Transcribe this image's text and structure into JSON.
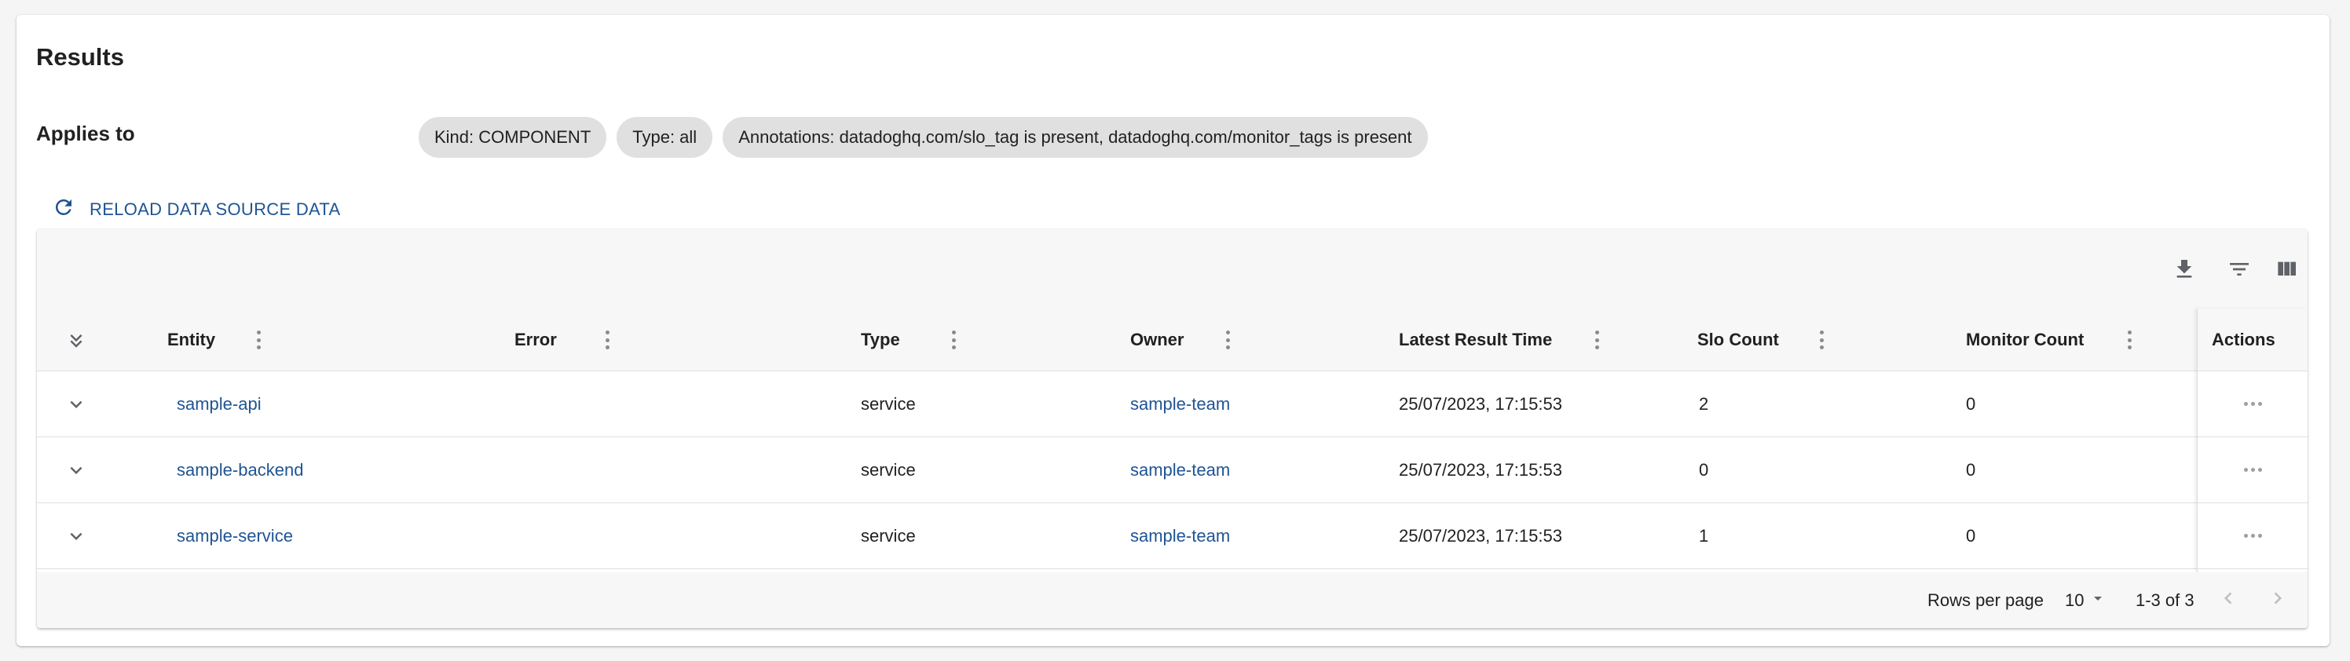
{
  "title": "Results",
  "applies_to": {
    "label": "Applies to",
    "chips": [
      "Kind: COMPONENT",
      "Type: all",
      "Annotations: datadoghq.com/slo_tag is present, datadoghq.com/monitor_tags is present"
    ]
  },
  "reload_label": "RELOAD DATA SOURCE DATA",
  "toolbar": {
    "icons": [
      "download-icon",
      "filter-icon",
      "columns-icon"
    ]
  },
  "table": {
    "columns": [
      "Entity",
      "Error",
      "Type",
      "Owner",
      "Latest Result Time",
      "Slo Count",
      "Monitor Count"
    ],
    "actions_header": "Actions",
    "rows": [
      {
        "entity": "sample-api",
        "error": "",
        "type": "service",
        "owner": "sample-team",
        "latest": "25/07/2023, 17:15:53",
        "slo": "2",
        "monitor": "0"
      },
      {
        "entity": "sample-backend",
        "error": "",
        "type": "service",
        "owner": "sample-team",
        "latest": "25/07/2023, 17:15:53",
        "slo": "0",
        "monitor": "0"
      },
      {
        "entity": "sample-service",
        "error": "",
        "type": "service",
        "owner": "sample-team",
        "latest": "25/07/2023, 17:15:53",
        "slo": "1",
        "monitor": "0"
      }
    ]
  },
  "pagination": {
    "rows_per_page_label": "Rows per page",
    "rows_per_page": "10",
    "range": "1-3 of 3"
  },
  "colors": {
    "link": "#1f5493",
    "chip_bg": "#e0e0e0",
    "header_bg": "#f7f7f7"
  }
}
